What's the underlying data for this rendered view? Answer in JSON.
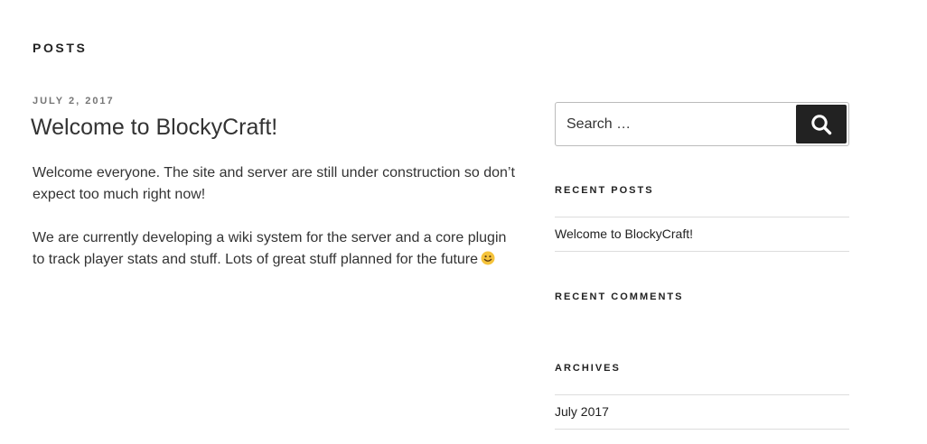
{
  "header": {
    "section_title": "Posts"
  },
  "post": {
    "date": "July 2, 2017",
    "title": "Welcome to BlockyCraft!",
    "paragraphs": [
      "Welcome everyone. The site and server are still under construction so don’t expect too much right now!",
      "We are currently developing a wiki system for the server and a core plugin to track player stats and stuff. Lots of great stuff planned for the future"
    ],
    "emoji_icon": "smiley-face-icon"
  },
  "sidebar": {
    "search": {
      "placeholder": "Search …",
      "button_label": "Search",
      "button_icon": "search-icon"
    },
    "recent_posts": {
      "title": "Recent Posts",
      "items": [
        "Welcome to BlockyCraft!"
      ]
    },
    "recent_comments": {
      "title": "Recent Comments"
    },
    "archives": {
      "title": "Archives",
      "items": [
        "July 2017"
      ]
    }
  },
  "colors": {
    "text": "#333333",
    "heading": "#222222",
    "meta": "#767676",
    "button_bg": "#222222",
    "divider": "#dddddd",
    "emoji": "#f5c33b"
  }
}
